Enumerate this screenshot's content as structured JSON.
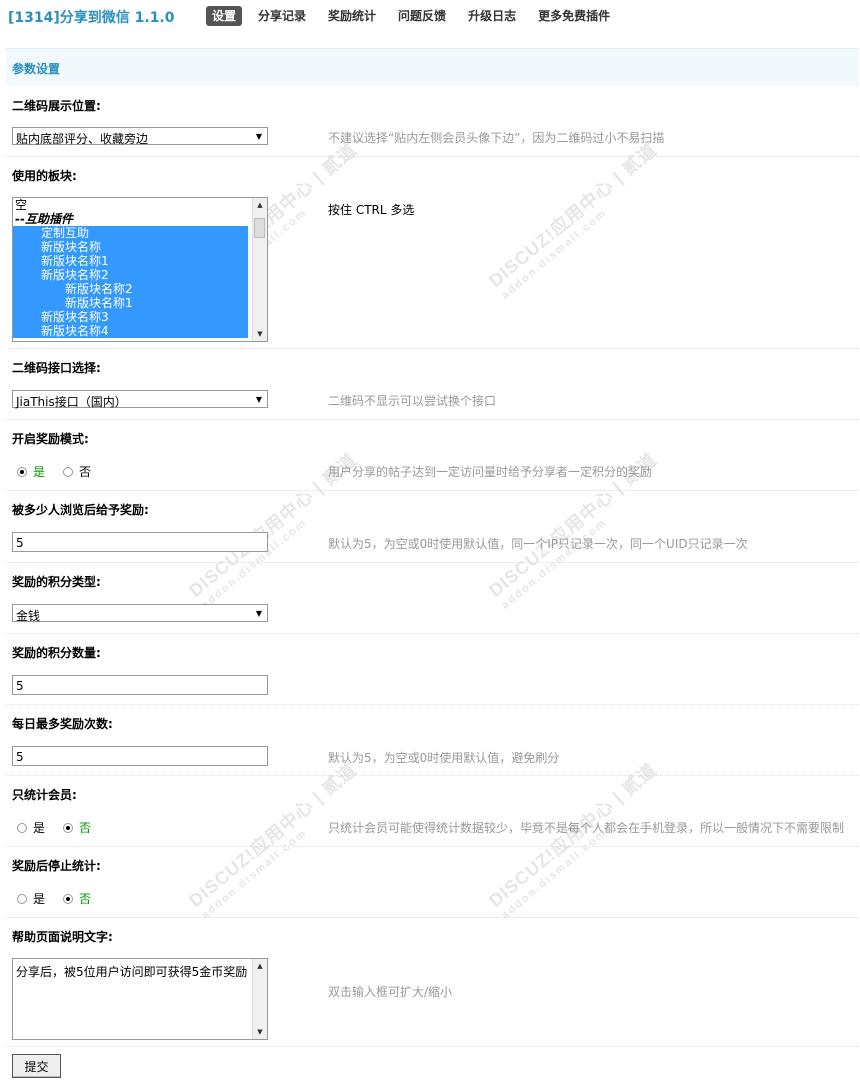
{
  "header": {
    "title": "[1314]分享到微信  1.1.0",
    "nav": [
      "设置",
      "分享记录",
      "奖励统计",
      "问题反馈",
      "升级日志",
      "更多免费插件"
    ],
    "active_tab": "设置"
  },
  "section_title": "参数设置",
  "watermark": {
    "main": "DISCUZ!应用中心 | 贰道",
    "sub": "addon.dismall.com"
  },
  "fields": {
    "qr_position": {
      "label": "二维码展示位置:",
      "value": "贴内底部评分、收藏旁边",
      "hint": "不建议选择“贴内左侧会员头像下边”，因为二维码过小不易扫描"
    },
    "forums": {
      "label": "使用的板块:",
      "hint": "按住 CTRL 多选",
      "options": [
        {
          "text": "空",
          "type": "normal"
        },
        {
          "text": "--互助插件",
          "type": "group"
        },
        {
          "text": "    定制互助",
          "type": "selected"
        },
        {
          "text": "    新版块名称",
          "type": "selected"
        },
        {
          "text": "    新版块名称1",
          "type": "selected"
        },
        {
          "text": "    新版块名称2",
          "type": "selected"
        },
        {
          "text": "        新版块名称2",
          "type": "selected"
        },
        {
          "text": "        新版块名称1",
          "type": "selected"
        },
        {
          "text": "    新版块名称3",
          "type": "selected"
        },
        {
          "text": "    新版块名称4",
          "type": "selected"
        }
      ]
    },
    "qr_api": {
      "label": "二维码接口选择:",
      "value": "JiaThis接口（国内）",
      "hint": "二维码不显示可以尝试换个接口"
    },
    "reward_mode": {
      "label": "开启奖励模式:",
      "yes": "是",
      "no": "否",
      "selected": "yes",
      "hint": "用户分享的帖子达到一定访问量时给予分享者一定积分的奖励"
    },
    "views_threshold": {
      "label": "被多少人浏览后给予奖励:",
      "value": "5",
      "hint": "默认为5，为空或0时使用默认值，同一个IP只记录一次，同一个UID只记录一次"
    },
    "credit_type": {
      "label": "奖励的积分类型:",
      "value": "金钱"
    },
    "credit_amount": {
      "label": "奖励的积分数量:",
      "value": "5"
    },
    "daily_max": {
      "label": "每日最多奖励次数:",
      "value": "5",
      "hint": "默认为5，为空或0时使用默认值，避免刷分"
    },
    "members_only": {
      "label": "只统计会员:",
      "yes": "是",
      "no": "否",
      "selected": "no",
      "hint": "只统计会员可能使得统计数据较少，毕竟不是每个人都会在手机登录，所以一般情况下不需要限制"
    },
    "stop_after_reward": {
      "label": "奖励后停止统计:",
      "yes": "是",
      "no": "否",
      "selected": "no"
    },
    "help_text": {
      "label": "帮助页面说明文字:",
      "value": "分享后，被5位用户访问即可获得5金币奖励",
      "hint": "双击输入框可扩大/缩小"
    }
  },
  "submit_label": "提交"
}
